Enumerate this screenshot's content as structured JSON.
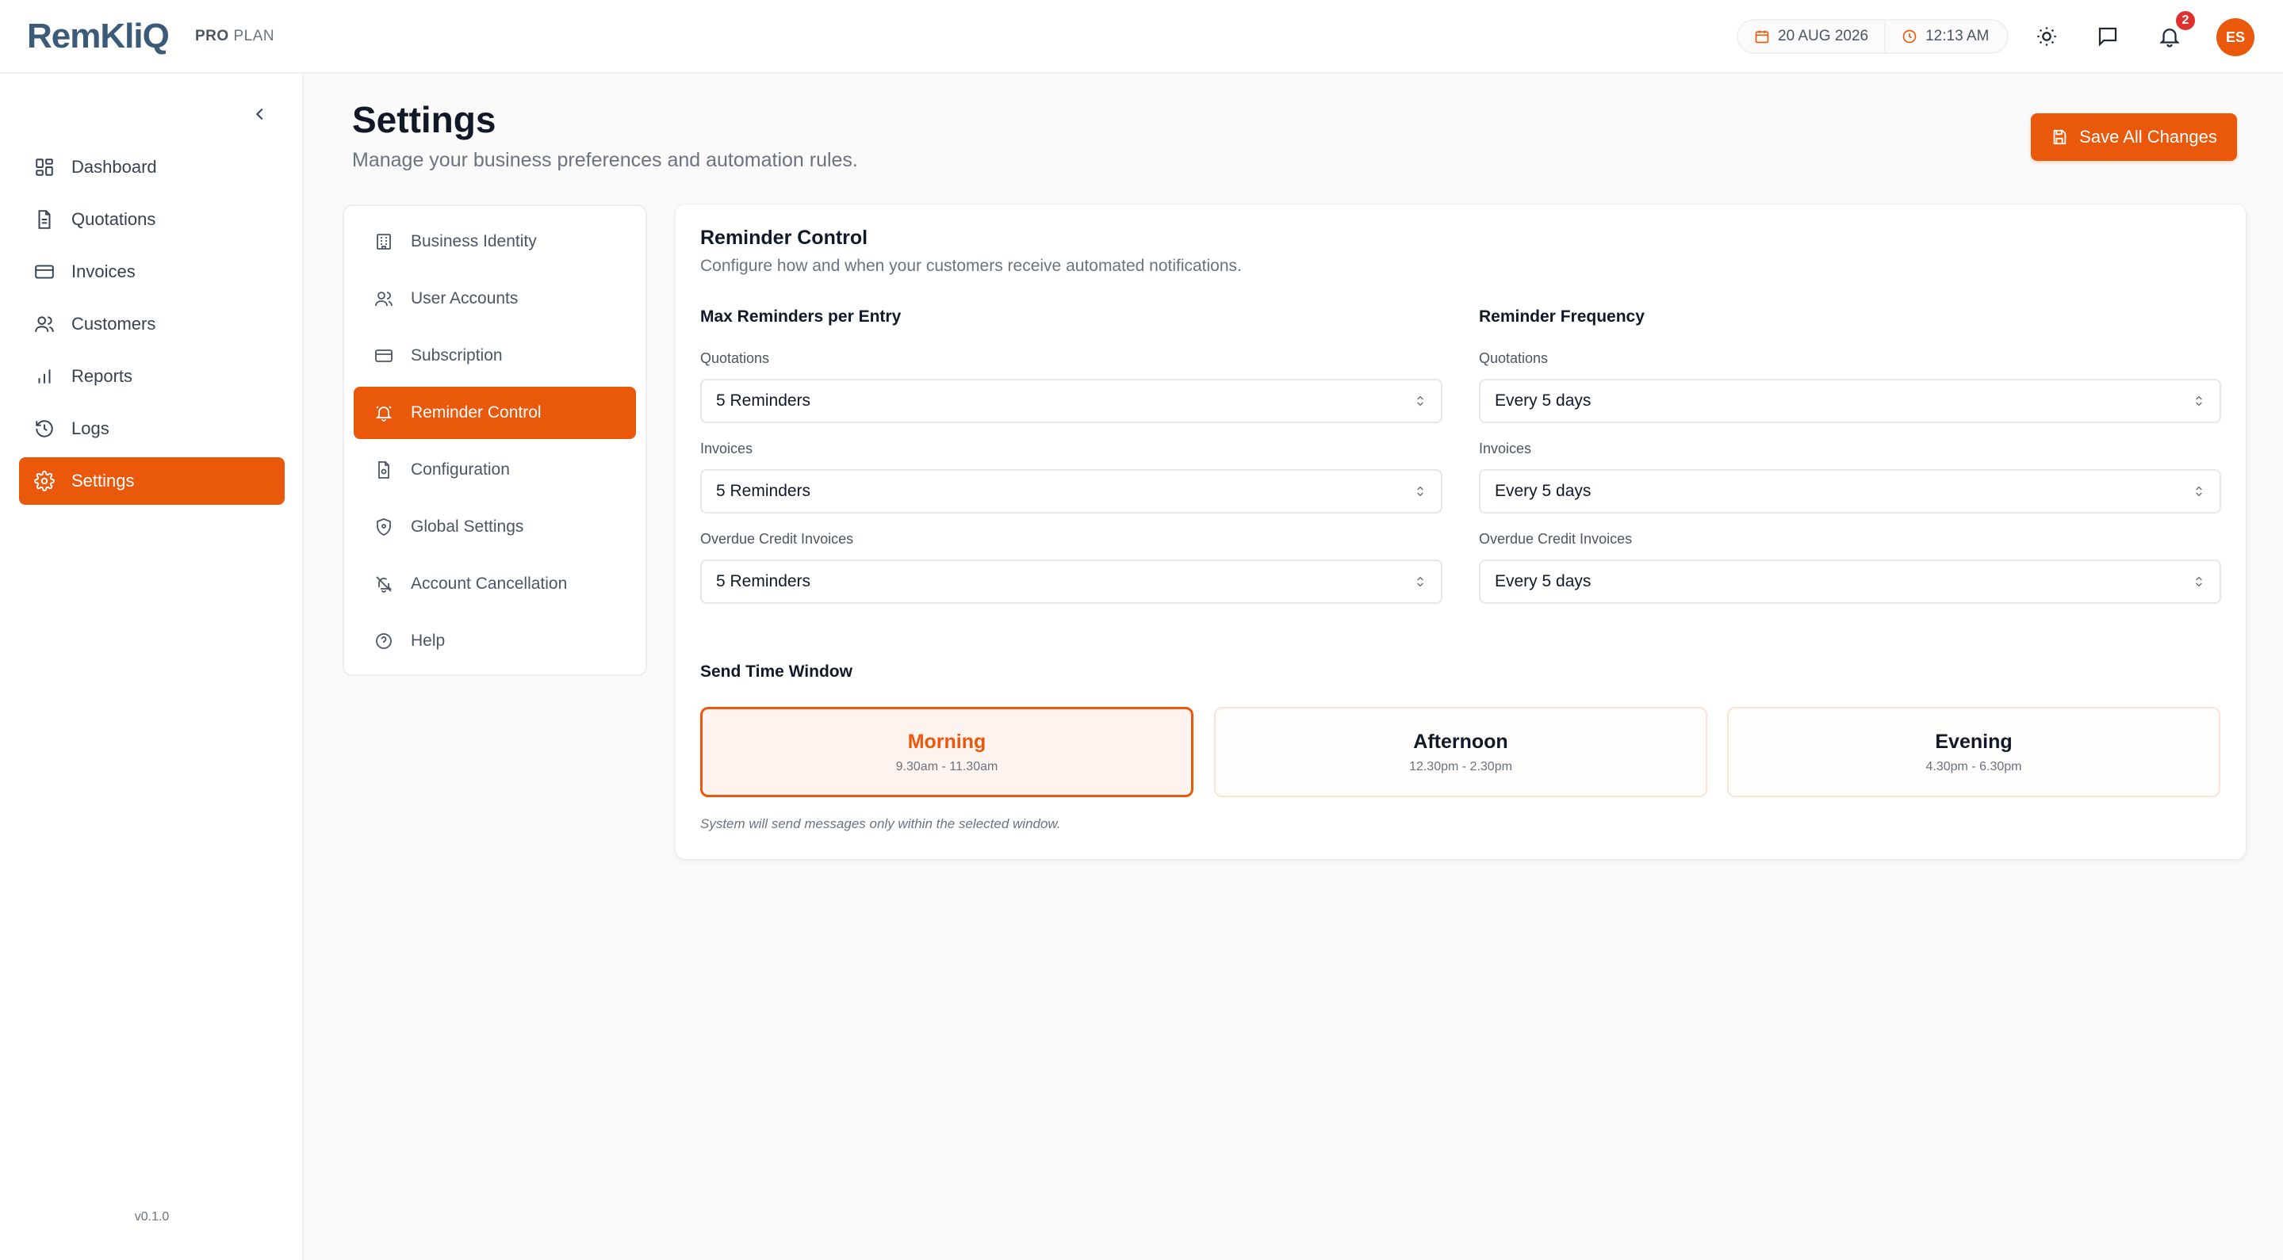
{
  "app": {
    "logo": "RemKliQ",
    "plan_bold": "PRO",
    "plan_rest": "PLAN",
    "date": "20 AUG 2026",
    "time": "12:13 AM",
    "notification_count": "2",
    "avatar_initials": "ES",
    "accent": "#ea580c"
  },
  "sidebar": {
    "items": [
      {
        "label": "Dashboard",
        "icon": "dashboard-icon"
      },
      {
        "label": "Quotations",
        "icon": "document-icon"
      },
      {
        "label": "Invoices",
        "icon": "card-icon"
      },
      {
        "label": "Customers",
        "icon": "users-icon"
      },
      {
        "label": "Reports",
        "icon": "bar-chart-icon"
      },
      {
        "label": "Logs",
        "icon": "history-icon"
      },
      {
        "label": "Settings",
        "icon": "gear-icon"
      }
    ],
    "version": "v0.1.0"
  },
  "page": {
    "title": "Settings",
    "subtitle": "Manage your business preferences and automation rules.",
    "save_label": "Save All Changes"
  },
  "settings_menu": {
    "items": [
      {
        "label": "Business Identity",
        "icon": "building-icon"
      },
      {
        "label": "User Accounts",
        "icon": "users-icon"
      },
      {
        "label": "Subscription",
        "icon": "card-icon"
      },
      {
        "label": "Reminder Control",
        "icon": "bell-icon"
      },
      {
        "label": "Configuration",
        "icon": "file-settings-icon"
      },
      {
        "label": "Global Settings",
        "icon": "shield-icon"
      },
      {
        "label": "Account Cancellation",
        "icon": "cancel-icon"
      },
      {
        "label": "Help",
        "icon": "help-icon"
      }
    ]
  },
  "reminder": {
    "title": "Reminder Control",
    "subtitle": "Configure how and when your customers receive automated notifications.",
    "max_heading": "Max Reminders per Entry",
    "freq_heading": "Reminder Frequency",
    "max": [
      {
        "label": "Quotations",
        "value": "5 Reminders"
      },
      {
        "label": "Invoices",
        "value": "5 Reminders"
      },
      {
        "label": "Overdue Credit Invoices",
        "value": "5 Reminders"
      }
    ],
    "freq": [
      {
        "label": "Quotations",
        "value": "Every 5 days"
      },
      {
        "label": "Invoices",
        "value": "Every 5 days"
      },
      {
        "label": "Overdue Credit Invoices",
        "value": "Every 5 days"
      }
    ],
    "window_heading": "Send Time Window",
    "windows": [
      {
        "name": "Morning",
        "time": "9.30am - 11.30am",
        "selected": true
      },
      {
        "name": "Afternoon",
        "time": "12.30pm - 2.30pm",
        "selected": false
      },
      {
        "name": "Evening",
        "time": "4.30pm - 6.30pm",
        "selected": false
      }
    ],
    "footnote": "System will send messages only within the selected window."
  }
}
